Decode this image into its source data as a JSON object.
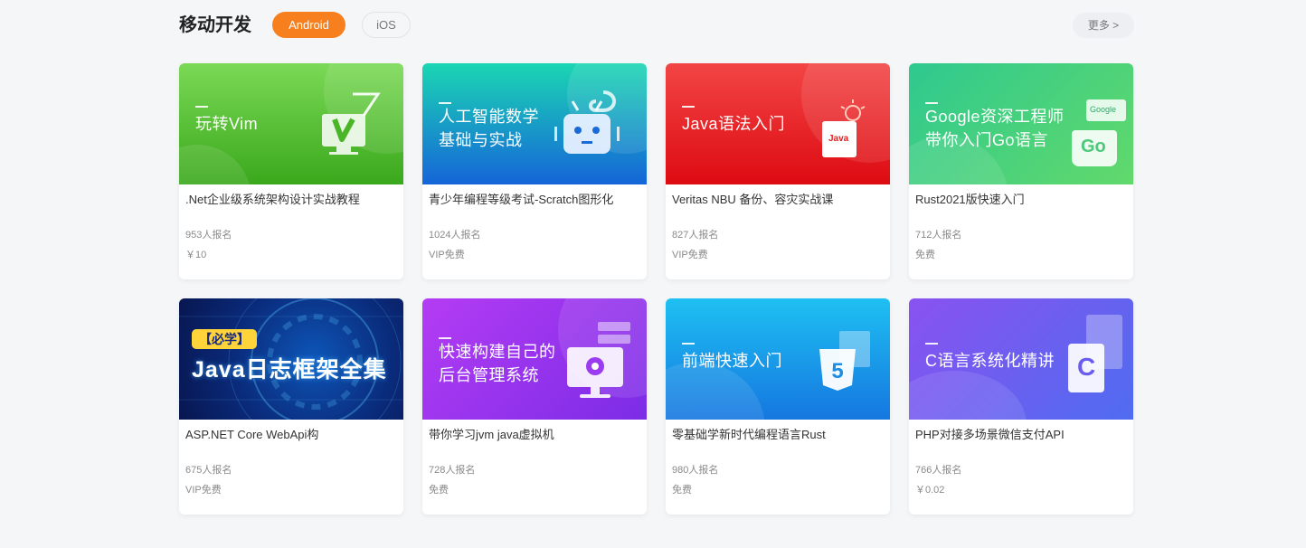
{
  "section": {
    "title": "移动开发",
    "tabs": [
      {
        "label": "Android",
        "active": true
      },
      {
        "label": "iOS",
        "active": false
      }
    ],
    "more_label": "更多 >"
  },
  "courses": [
    {
      "cover_lines": [
        "玩转Vim"
      ],
      "title": ".Net企业级系统架构设计实战教程",
      "enrolled": "953人报名",
      "price": "￥10",
      "icon": "vim-logo-icon"
    },
    {
      "cover_lines": [
        "人工智能数学",
        "基础与实战"
      ],
      "title": "青少年编程等级考试-Scratch图形化",
      "enrolled": "1024人报名",
      "price": "VIP免费",
      "icon": "robot-python-icon"
    },
    {
      "cover_lines": [
        "Java语法入门"
      ],
      "title": "Veritas NBU 备份、容灾实战课",
      "enrolled": "827人报名",
      "price": "VIP免费",
      "icon": "java-file-icon",
      "icon_text": "Java"
    },
    {
      "cover_lines": [
        "Google资深工程师",
        "带你入门Go语言"
      ],
      "title": "Rust2021版快速入门",
      "enrolled": "712人报名",
      "price": "免费",
      "icon": "go-bag-icon",
      "icon_text": "Go",
      "icon_text2": "Google"
    },
    {
      "cover_badge": "【必学】",
      "cover_big": "Java日志框架全集",
      "title": "ASP.NET Core WebApi构",
      "enrolled": "675人报名",
      "price": "VIP免费",
      "icon": "tech-circles-icon"
    },
    {
      "cover_lines": [
        "快速构建自己的",
        "后台管理系统"
      ],
      "title": "带你学习jvm java虚拟机",
      "enrolled": "728人报名",
      "price": "免费",
      "icon": "monitor-gear-icon"
    },
    {
      "cover_lines": [
        "前端快速入门"
      ],
      "title": "零基础学新时代编程语言Rust",
      "enrolled": "980人报名",
      "price": "免费",
      "icon": "html5-icon",
      "icon_text": "5"
    },
    {
      "cover_lines": [
        "C语言系统化精讲"
      ],
      "title": "PHP对接多场景微信支付API",
      "enrolled": "766人报名",
      "price": "￥0.02",
      "icon": "c-lang-icon",
      "icon_text": "C"
    }
  ],
  "colors": {
    "accent": "#f77f1d",
    "cover_gradients": [
      [
        "#7bd956",
        "#3aa81c"
      ],
      [
        "#1bd6b3",
        "#1565d8"
      ],
      [
        "#f24545",
        "#dd0b12"
      ],
      [
        "#2ec98f",
        "#62d96b"
      ],
      [
        "#0a1a5a",
        "#0a3f8e"
      ],
      [
        "#b43cf4",
        "#7c2ce6"
      ],
      [
        "#1ec0f2",
        "#1577e0"
      ],
      [
        "#8a52f0",
        "#4f6cf0"
      ]
    ]
  }
}
